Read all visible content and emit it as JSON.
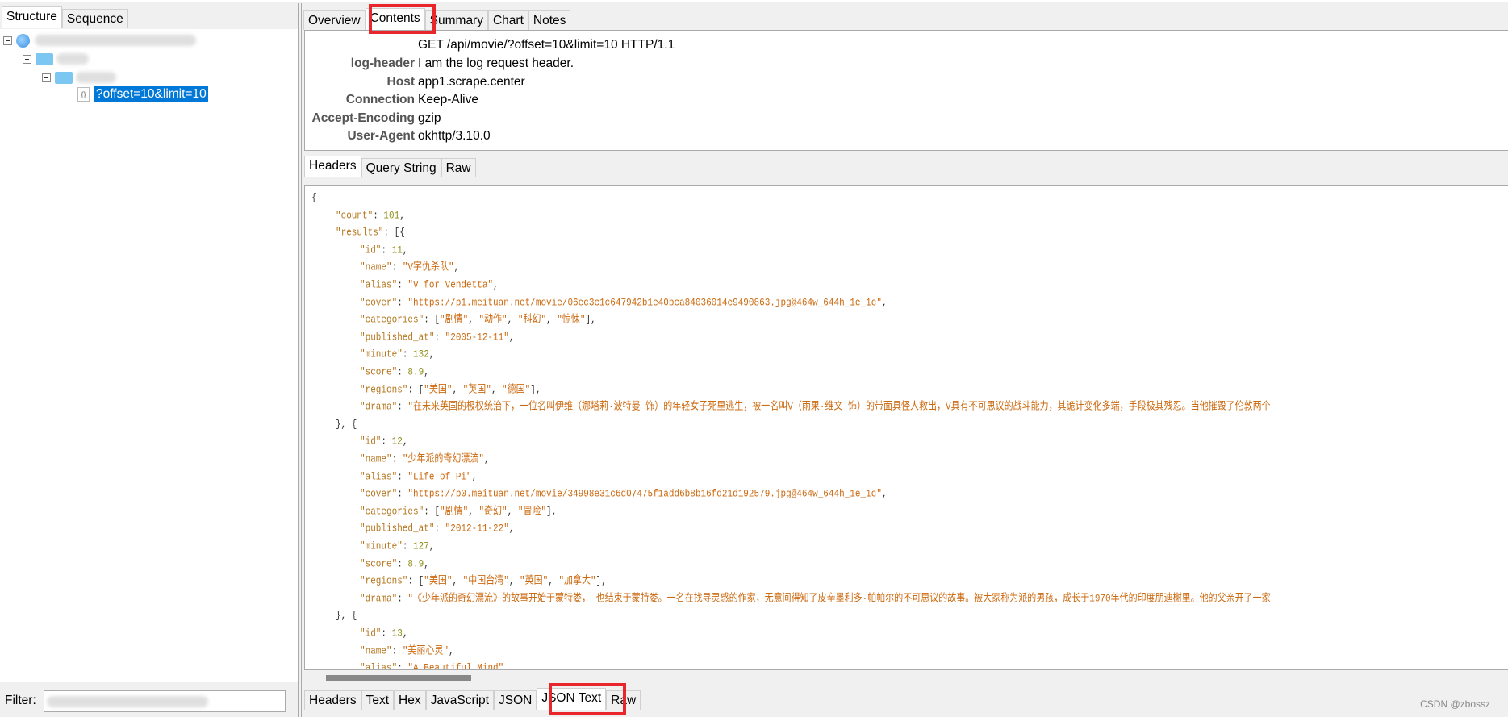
{
  "left_tabs": [
    {
      "label": "Structure",
      "active": true
    },
    {
      "label": "Sequence",
      "active": false
    }
  ],
  "tree": {
    "selected_item": "?offset=10&limit=10",
    "icons": [
      "globe-icon",
      "folder-icon",
      "folder-icon",
      "file-icon"
    ]
  },
  "filter": {
    "label": "Filter:",
    "value": ""
  },
  "main_tabs": [
    {
      "label": "Overview"
    },
    {
      "label": "Contents",
      "active": true
    },
    {
      "label": "Summary"
    },
    {
      "label": "Chart"
    },
    {
      "label": "Notes"
    }
  ],
  "request": {
    "request_line": "GET /api/movie/?offset=10&limit=10 HTTP/1.1",
    "headers": [
      {
        "name": "log-header",
        "value": "I am the log request header."
      },
      {
        "name": "Host",
        "value": "app1.scrape.center"
      },
      {
        "name": "Connection",
        "value": "Keep-Alive"
      },
      {
        "name": "Accept-Encoding",
        "value": "gzip"
      },
      {
        "name": "User-Agent",
        "value": "okhttp/3.10.0"
      }
    ]
  },
  "request_tabs": [
    {
      "label": "Headers",
      "active": true
    },
    {
      "label": "Query String"
    },
    {
      "label": "Raw"
    }
  ],
  "response_tabs": [
    {
      "label": "Headers"
    },
    {
      "label": "Text"
    },
    {
      "label": "Hex"
    },
    {
      "label": "JavaScript"
    },
    {
      "label": "JSON"
    },
    {
      "label": "JSON Text",
      "active": true
    },
    {
      "label": "Raw"
    }
  ],
  "colors": {
    "key": "#b5761e",
    "string": "#cc6a10",
    "number": "#8f8f1a",
    "selection": "#0078d7",
    "highlight_box": "#e8262c"
  },
  "json_lines": [
    {
      "level": 0,
      "tokens": [
        [
          "p",
          "{"
        ]
      ]
    },
    {
      "level": 1,
      "tokens": [
        [
          "k",
          "\"count\""
        ],
        [
          "p",
          ": "
        ],
        [
          "n",
          "101"
        ],
        [
          "p",
          ","
        ]
      ]
    },
    {
      "level": 1,
      "tokens": [
        [
          "k",
          "\"results\""
        ],
        [
          "p",
          ": [{"
        ]
      ]
    },
    {
      "level": 2,
      "tokens": [
        [
          "k",
          "\"id\""
        ],
        [
          "p",
          ": "
        ],
        [
          "n",
          "11"
        ],
        [
          "p",
          ","
        ]
      ]
    },
    {
      "level": 2,
      "tokens": [
        [
          "k",
          "\"name\""
        ],
        [
          "p",
          ": "
        ],
        [
          "s",
          "\"V字仇杀队\""
        ],
        [
          "p",
          ","
        ]
      ]
    },
    {
      "level": 2,
      "tokens": [
        [
          "k",
          "\"alias\""
        ],
        [
          "p",
          ": "
        ],
        [
          "s",
          "\"V for Vendetta\""
        ],
        [
          "p",
          ","
        ]
      ]
    },
    {
      "level": 2,
      "tokens": [
        [
          "k",
          "\"cover\""
        ],
        [
          "p",
          ": "
        ],
        [
          "s",
          "\"https://p1.meituan.net/movie/06ec3c1c647942b1e40bca84036014e9490863.jpg@464w_644h_1e_1c\""
        ],
        [
          "p",
          ","
        ]
      ]
    },
    {
      "level": 2,
      "tokens": [
        [
          "k",
          "\"categories\""
        ],
        [
          "p",
          ": ["
        ],
        [
          "s",
          "\"剧情\""
        ],
        [
          "p",
          ", "
        ],
        [
          "s",
          "\"动作\""
        ],
        [
          "p",
          ", "
        ],
        [
          "s",
          "\"科幻\""
        ],
        [
          "p",
          ", "
        ],
        [
          "s",
          "\"惊悚\""
        ],
        [
          "p",
          "],"
        ]
      ]
    },
    {
      "level": 2,
      "tokens": [
        [
          "k",
          "\"published_at\""
        ],
        [
          "p",
          ": "
        ],
        [
          "s",
          "\"2005-12-11\""
        ],
        [
          "p",
          ","
        ]
      ]
    },
    {
      "level": 2,
      "tokens": [
        [
          "k",
          "\"minute\""
        ],
        [
          "p",
          ": "
        ],
        [
          "n",
          "132"
        ],
        [
          "p",
          ","
        ]
      ]
    },
    {
      "level": 2,
      "tokens": [
        [
          "k",
          "\"score\""
        ],
        [
          "p",
          ": "
        ],
        [
          "n",
          "8.9"
        ],
        [
          "p",
          ","
        ]
      ]
    },
    {
      "level": 2,
      "tokens": [
        [
          "k",
          "\"regions\""
        ],
        [
          "p",
          ": ["
        ],
        [
          "s",
          "\"美国\""
        ],
        [
          "p",
          ", "
        ],
        [
          "s",
          "\"英国\""
        ],
        [
          "p",
          ", "
        ],
        [
          "s",
          "\"德国\""
        ],
        [
          "p",
          "],"
        ]
      ]
    },
    {
      "level": 2,
      "tokens": [
        [
          "k",
          "\"drama\""
        ],
        [
          "p",
          ": "
        ],
        [
          "s",
          "\"在未来英国的极权统治下，一位名叫伊维（娜塔莉·波特曼 饰）的年轻女子死里逃生，被一名叫V（雨果·维文 饰）的带面具怪人救出，V具有不可思议的战斗能力，其诡计变化多端，手段极其残忍。当他摧毁了伦敦两个"
        ]
      ]
    },
    {
      "level": 1,
      "tokens": [
        [
          "p",
          "}, {"
        ]
      ]
    },
    {
      "level": 2,
      "tokens": [
        [
          "k",
          "\"id\""
        ],
        [
          "p",
          ": "
        ],
        [
          "n",
          "12"
        ],
        [
          "p",
          ","
        ]
      ]
    },
    {
      "level": 2,
      "tokens": [
        [
          "k",
          "\"name\""
        ],
        [
          "p",
          ": "
        ],
        [
          "s",
          "\"少年派的奇幻漂流\""
        ],
        [
          "p",
          ","
        ]
      ]
    },
    {
      "level": 2,
      "tokens": [
        [
          "k",
          "\"alias\""
        ],
        [
          "p",
          ": "
        ],
        [
          "s",
          "\"Life of Pi\""
        ],
        [
          "p",
          ","
        ]
      ]
    },
    {
      "level": 2,
      "tokens": [
        [
          "k",
          "\"cover\""
        ],
        [
          "p",
          ": "
        ],
        [
          "s",
          "\"https://p0.meituan.net/movie/34998e31c6d07475f1add6b8b16fd21d192579.jpg@464w_644h_1e_1c\""
        ],
        [
          "p",
          ","
        ]
      ]
    },
    {
      "level": 2,
      "tokens": [
        [
          "k",
          "\"categories\""
        ],
        [
          "p",
          ": ["
        ],
        [
          "s",
          "\"剧情\""
        ],
        [
          "p",
          ", "
        ],
        [
          "s",
          "\"奇幻\""
        ],
        [
          "p",
          ", "
        ],
        [
          "s",
          "\"冒险\""
        ],
        [
          "p",
          "],"
        ]
      ]
    },
    {
      "level": 2,
      "tokens": [
        [
          "k",
          "\"published_at\""
        ],
        [
          "p",
          ": "
        ],
        [
          "s",
          "\"2012-11-22\""
        ],
        [
          "p",
          ","
        ]
      ]
    },
    {
      "level": 2,
      "tokens": [
        [
          "k",
          "\"minute\""
        ],
        [
          "p",
          ": "
        ],
        [
          "n",
          "127"
        ],
        [
          "p",
          ","
        ]
      ]
    },
    {
      "level": 2,
      "tokens": [
        [
          "k",
          "\"score\""
        ],
        [
          "p",
          ": "
        ],
        [
          "n",
          "8.9"
        ],
        [
          "p",
          ","
        ]
      ]
    },
    {
      "level": 2,
      "tokens": [
        [
          "k",
          "\"regions\""
        ],
        [
          "p",
          ": ["
        ],
        [
          "s",
          "\"美国\""
        ],
        [
          "p",
          ", "
        ],
        [
          "s",
          "\"中国台湾\""
        ],
        [
          "p",
          ", "
        ],
        [
          "s",
          "\"英国\""
        ],
        [
          "p",
          ", "
        ],
        [
          "s",
          "\"加拿大\""
        ],
        [
          "p",
          "],"
        ]
      ]
    },
    {
      "level": 2,
      "tokens": [
        [
          "k",
          "\"drama\""
        ],
        [
          "p",
          ": "
        ],
        [
          "s",
          "\"《少年派的奇幻漂流》的故事开始于蒙特娄， 也结束于蒙特娄。一名在找寻灵感的作家，无意间得知了皮辛墨利多·帕帕尔的不可思议的故事。被大家称为派的男孩，成长于1970年代的印度朋迪榭里。他的父亲开了一家"
        ]
      ]
    },
    {
      "level": 1,
      "tokens": [
        [
          "p",
          "}, {"
        ]
      ]
    },
    {
      "level": 2,
      "tokens": [
        [
          "k",
          "\"id\""
        ],
        [
          "p",
          ": "
        ],
        [
          "n",
          "13"
        ],
        [
          "p",
          ","
        ]
      ]
    },
    {
      "level": 2,
      "tokens": [
        [
          "k",
          "\"name\""
        ],
        [
          "p",
          ": "
        ],
        [
          "s",
          "\"美丽心灵\""
        ],
        [
          "p",
          ","
        ]
      ]
    },
    {
      "level": 2,
      "tokens": [
        [
          "k",
          "\"alias\""
        ],
        [
          "p",
          ": "
        ],
        [
          "s",
          "\"A Beautiful Mind\""
        ],
        [
          "p",
          ","
        ]
      ]
    }
  ],
  "watermark": "CSDN @zbossz"
}
